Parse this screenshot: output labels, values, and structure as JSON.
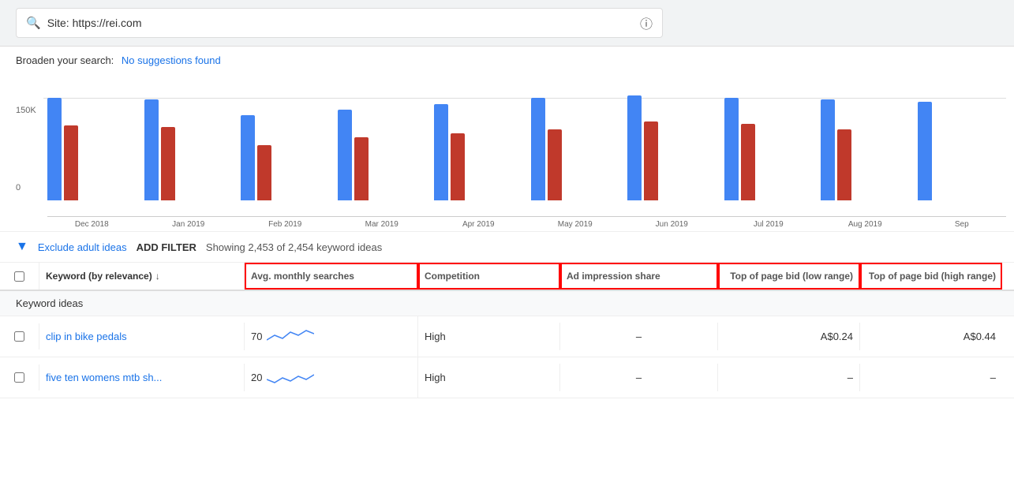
{
  "search_bar": {
    "value": "Site: https://rei.com",
    "icon": "🔍",
    "info_icon": "ⓘ"
  },
  "broaden": {
    "label": "Broaden your search:",
    "suggestion": "No suggestions found"
  },
  "chart": {
    "y_label": "150K",
    "zero_label": "0",
    "months": [
      "Dec 2018",
      "Jan 2019",
      "Feb 2019",
      "Mar 2019",
      "Apr 2019",
      "May 2019",
      "Jun 2019",
      "Jul 2019",
      "Aug 2019",
      "Sep"
    ],
    "bars": [
      {
        "blue": 130,
        "red": 95
      },
      {
        "blue": 128,
        "red": 93
      },
      {
        "blue": 108,
        "red": 70
      },
      {
        "blue": 115,
        "red": 80
      },
      {
        "blue": 122,
        "red": 85
      },
      {
        "blue": 130,
        "red": 90
      },
      {
        "blue": 133,
        "red": 100
      },
      {
        "blue": 130,
        "red": 97
      },
      {
        "blue": 128,
        "red": 90
      },
      {
        "blue": 125,
        "red": 0
      }
    ]
  },
  "filter_bar": {
    "filter_icon": "▼",
    "exclude_label": "Exclude adult ideas",
    "add_filter_label": "ADD FILTER",
    "showing_text": "Showing 2,453 of 2,454 keyword ideas"
  },
  "table": {
    "headers": [
      {
        "id": "checkbox",
        "label": "",
        "highlighted": false
      },
      {
        "id": "keyword",
        "label": "Keyword (by relevance)",
        "sort": true,
        "highlighted": false
      },
      {
        "id": "avg_monthly",
        "label": "Avg. monthly searches",
        "highlighted": true
      },
      {
        "id": "competition",
        "label": "Competition",
        "highlighted": true
      },
      {
        "id": "ad_impression",
        "label": "Ad impression share",
        "highlighted": true
      },
      {
        "id": "top_bid_low",
        "label": "Top of page bid (low range)",
        "highlighted": true
      },
      {
        "id": "top_bid_high",
        "label": "Top of page bid (high range)",
        "highlighted": true
      }
    ],
    "keyword_ideas_label": "Keyword ideas",
    "rows": [
      {
        "keyword": "clip in bike pedals",
        "avg_monthly": "70",
        "competition": "High",
        "ad_impression": "–",
        "top_bid_low": "A$0.24",
        "top_bid_high": "A$0.44"
      },
      {
        "keyword": "five ten womens mtb sh...",
        "avg_monthly": "20",
        "competition": "High",
        "ad_impression": "–",
        "top_bid_low": "–",
        "top_bid_high": "–"
      }
    ]
  }
}
